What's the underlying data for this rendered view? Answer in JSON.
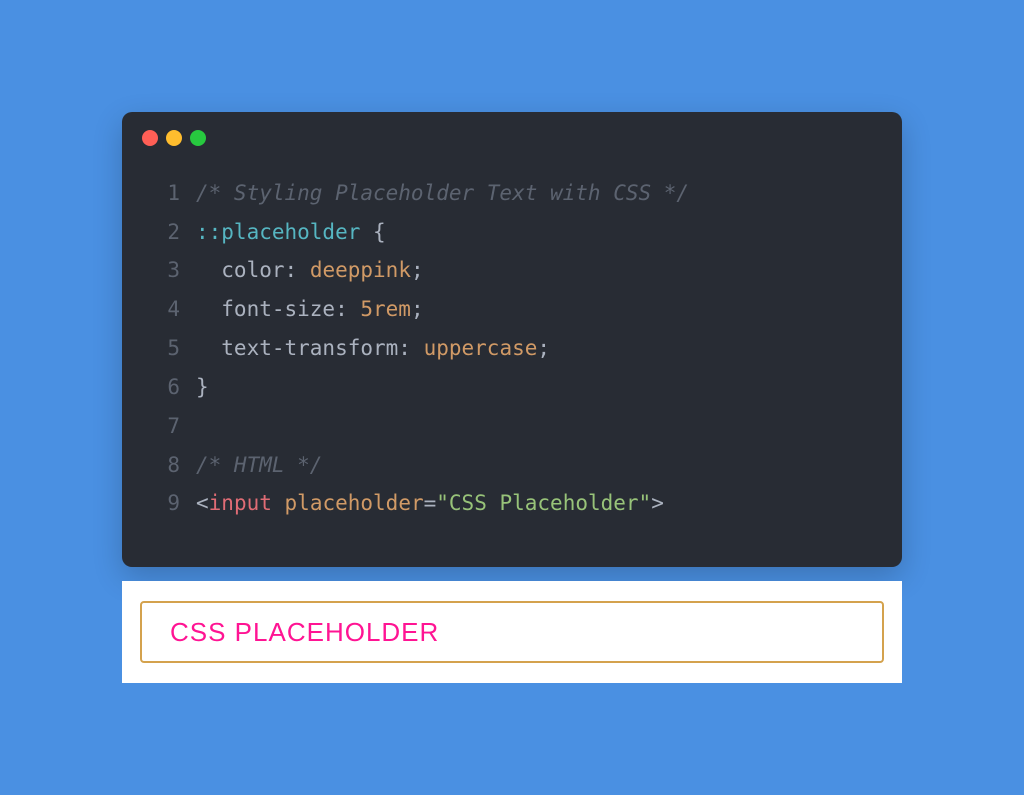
{
  "colors": {
    "bg": "#4a90e2",
    "editor_bg": "#282c34",
    "comment": "#5c6370",
    "pseudo": "#56b6c2",
    "value": "#d19a66",
    "tag": "#e06c75",
    "string": "#98c379",
    "default": "#abb2bf",
    "placeholder": "#ff1493",
    "input_border": "#d4a24d"
  },
  "window_controls": [
    "red",
    "yellow",
    "green"
  ],
  "code_lines": [
    {
      "n": "1",
      "tokens": [
        {
          "t": "/* Styling Placeholder Text with CSS */",
          "c": "tok-comment"
        }
      ]
    },
    {
      "n": "2",
      "tokens": [
        {
          "t": "::placeholder",
          "c": "tok-pseudo"
        },
        {
          "t": " {",
          "c": "tok-brace"
        }
      ]
    },
    {
      "n": "3",
      "tokens": [
        {
          "t": "  color",
          "c": "tok-prop"
        },
        {
          "t": ": ",
          "c": "tok-colon"
        },
        {
          "t": "deeppink",
          "c": "tok-value"
        },
        {
          "t": ";",
          "c": "tok-semi"
        }
      ]
    },
    {
      "n": "4",
      "tokens": [
        {
          "t": "  font-size",
          "c": "tok-prop"
        },
        {
          "t": ": ",
          "c": "tok-colon"
        },
        {
          "t": "5rem",
          "c": "tok-value"
        },
        {
          "t": ";",
          "c": "tok-semi"
        }
      ]
    },
    {
      "n": "5",
      "tokens": [
        {
          "t": "  text-transform",
          "c": "tok-prop"
        },
        {
          "t": ": ",
          "c": "tok-colon"
        },
        {
          "t": "uppercase",
          "c": "tok-value"
        },
        {
          "t": ";",
          "c": "tok-semi"
        }
      ]
    },
    {
      "n": "6",
      "tokens": [
        {
          "t": "}",
          "c": "tok-brace"
        }
      ]
    },
    {
      "n": "7",
      "tokens": []
    },
    {
      "n": "8",
      "tokens": [
        {
          "t": "/* HTML */",
          "c": "tok-comment"
        }
      ]
    },
    {
      "n": "9",
      "tokens": [
        {
          "t": "<",
          "c": "tok-angle"
        },
        {
          "t": "input",
          "c": "tok-tag"
        },
        {
          "t": " ",
          "c": "tok-prop"
        },
        {
          "t": "placeholder",
          "c": "tok-attr"
        },
        {
          "t": "=",
          "c": "tok-eq"
        },
        {
          "t": "\"CSS Placeholder\"",
          "c": "tok-string"
        },
        {
          "t": ">",
          "c": "tok-angle"
        }
      ]
    }
  ],
  "preview": {
    "placeholder": "CSS Placeholder"
  }
}
